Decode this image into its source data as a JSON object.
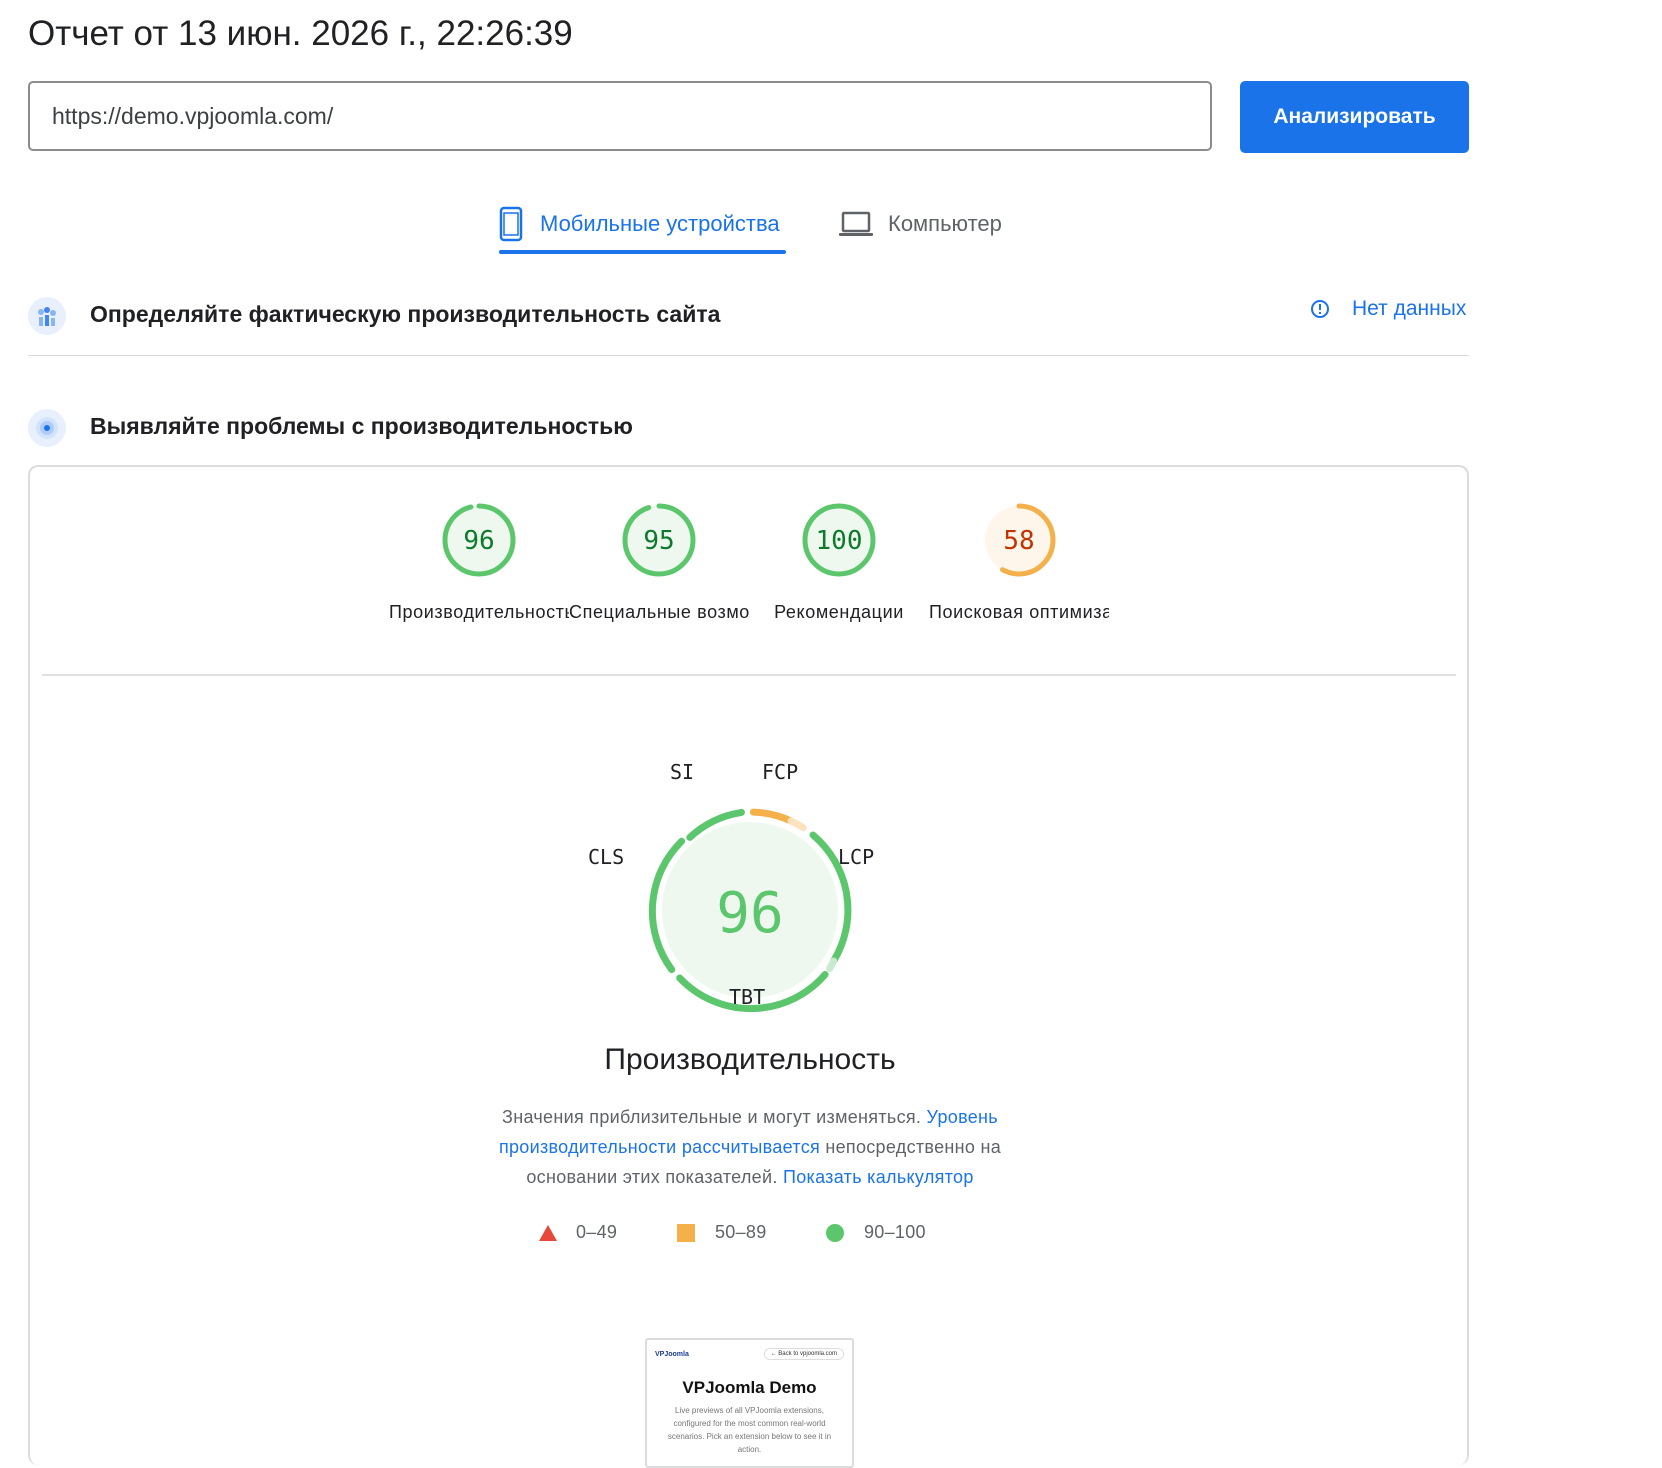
{
  "report_title": "Отчет от 13 июн. 2026 г., 22:26:39",
  "url_input": {
    "value": "https://demo.vpjoomla.com/"
  },
  "analyze_button": "Анализировать",
  "tabs": [
    {
      "label": "Мобильные устройства",
      "icon": "smartphone-icon",
      "active": true
    },
    {
      "label": "Компьютер",
      "icon": "laptop-icon",
      "active": false
    }
  ],
  "field_data": {
    "title": "Определяйте фактическую производительность сайта",
    "status": "Нет данных",
    "icon": "field-data-icon",
    "status_icon": "info-icon"
  },
  "lab_data": {
    "title": "Выявляйте проблемы с производительностью",
    "icon": "radar-icon"
  },
  "category_scores": [
    {
      "label": "Производительность",
      "score": "96",
      "rating": "pass"
    },
    {
      "label": "Специальные возможности",
      "score": "95",
      "rating": "pass"
    },
    {
      "label": "Рекомендации",
      "score": "100",
      "rating": "pass"
    },
    {
      "label": "Поисковая оптимизация",
      "score": "58",
      "rating": "average"
    }
  ],
  "performance": {
    "score": "96",
    "title": "Производительность",
    "metrics": [
      {
        "label": "FCP",
        "rating": "average"
      },
      {
        "label": "LCP",
        "rating": "pass"
      },
      {
        "label": "TBT",
        "rating": "pass"
      },
      {
        "label": "CLS",
        "rating": "pass"
      },
      {
        "label": "SI",
        "rating": "pass"
      }
    ],
    "description": {
      "text1": "Значения приблизительные и могут изменяться. ",
      "link1": "Уровень производительности рассчитывается",
      "text2": " непосредственно на основании этих показателей. ",
      "link2": "Показать калькулятор"
    },
    "legend": [
      {
        "range": "0–49",
        "shape": "triangle",
        "color": "#e8473b"
      },
      {
        "range": "50–89",
        "shape": "square",
        "color": "#f4b04a"
      },
      {
        "range": "90–100",
        "shape": "circle",
        "color": "#5cc66d"
      }
    ]
  },
  "screenshot": {
    "logo": "VPJoomla",
    "back_link": "← Back to vpjoomla.com",
    "title": "VPJoomla Demo",
    "text": "Live previews of all VPJoomla extensions, configured for the most common real-world scenarios. Pick an extension below to see it in action."
  },
  "colors": {
    "accent": "#1a73e8",
    "pass": "#5cc66d",
    "pass_text": "#0d7a2c",
    "pass_fill": "#eef8ef",
    "average": "#f4b04a",
    "average_text": "#c33300",
    "average_fill": "#fef6ea",
    "fail": "#e8473b"
  }
}
